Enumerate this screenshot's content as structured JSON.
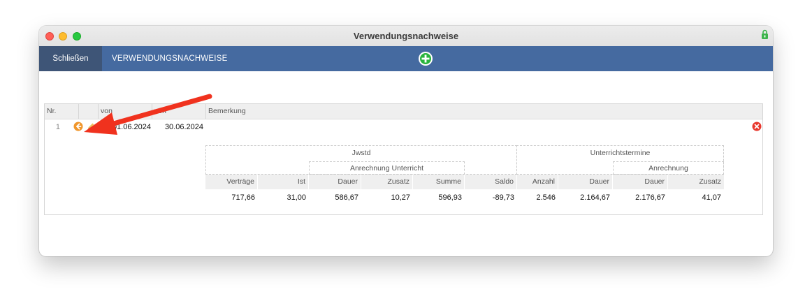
{
  "window": {
    "title": "Verwendungsnachweise"
  },
  "toolbar": {
    "close_label": "Schließen",
    "section_label": "VERWENDUNGSNACHWEISE"
  },
  "table": {
    "headers": [
      "Nr.",
      "",
      "von",
      "von",
      "Bemerkung"
    ],
    "row": {
      "nr": "1",
      "from": "01.06.2024",
      "to": "30.06.2024",
      "remark": ""
    }
  },
  "details": {
    "group_jwstd": "Jwstd",
    "group_anrechnung_unterricht": "Anrechnung Unterricht",
    "group_unterrichtstermine": "Unterrichtstermine",
    "group_anrechnung": "Anrechnung",
    "columns": [
      "Verträge",
      "Ist",
      "Dauer",
      "Zusatz",
      "Summe",
      "Saldo",
      "Anzahl",
      "Dauer",
      "Dauer",
      "Zusatz"
    ],
    "values": [
      "717,66",
      "31,00",
      "586,67",
      "10,27",
      "596,93",
      "-89,73",
      "2.546",
      "2.164,67",
      "2.176,67",
      "41,07"
    ]
  },
  "colors": {
    "toolbar": "#456aa0",
    "toolbar_active": "#3e5577",
    "arrow": "#f0321e",
    "action_icon": "#f0962b"
  }
}
